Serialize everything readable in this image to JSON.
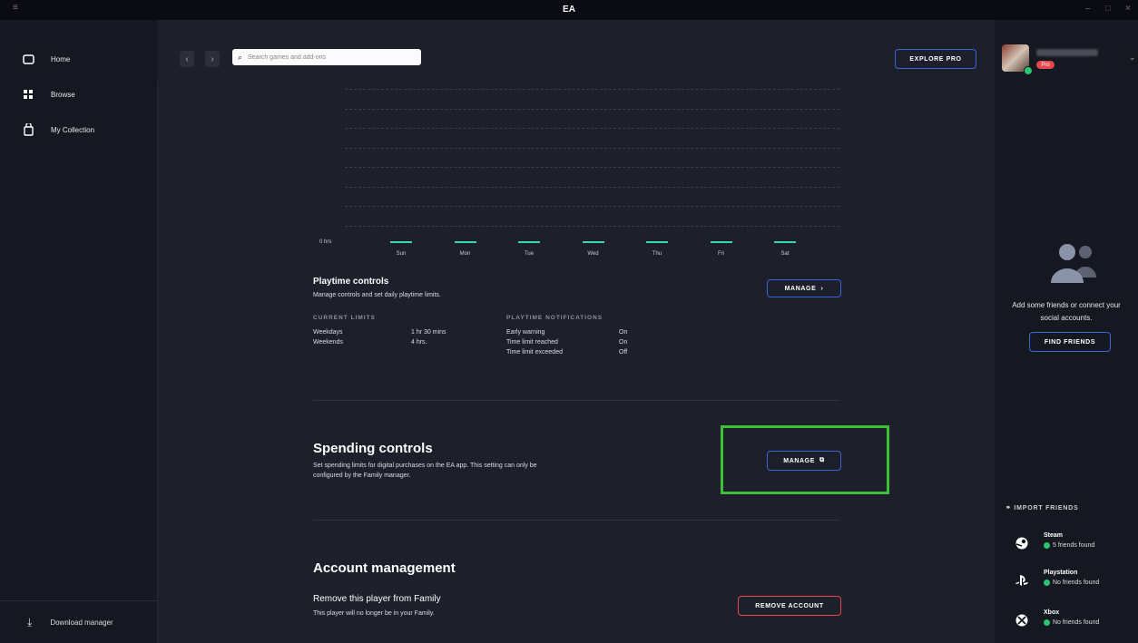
{
  "window": {
    "title": "EA"
  },
  "sidebar": {
    "items": [
      {
        "label": "Home",
        "icon": "home-icon"
      },
      {
        "label": "Browse",
        "icon": "browse-icon"
      },
      {
        "label": "My Collection",
        "icon": "collection-icon"
      }
    ],
    "download_manager": "Download manager"
  },
  "search": {
    "placeholder": "Search games and add-ons"
  },
  "explore_button": "EXPLORE PRO",
  "profile": {
    "badge": "Pro"
  },
  "chart_data": {
    "type": "bar",
    "categories": [
      "Sun",
      "Mon",
      "Tue",
      "Wed",
      "Thu",
      "Fri",
      "Sat"
    ],
    "values": [
      0,
      0,
      0,
      0,
      0,
      0,
      0
    ],
    "ylabel_zero": "0 hrs",
    "grid": true
  },
  "playtime": {
    "title": "Playtime controls",
    "desc": "Manage controls and set daily playtime limits.",
    "manage_label": "MANAGE",
    "current_limits_caption": "CURRENT LIMITS",
    "limits": [
      {
        "label": "Weekdays",
        "value": "1 hr 30 mins"
      },
      {
        "label": "Weekends",
        "value": "4 hrs."
      }
    ],
    "notifications_caption": "PLAYTIME NOTIFICATIONS",
    "notifications": [
      {
        "label": "Early warning",
        "value": "On"
      },
      {
        "label": "Time limit reached",
        "value": "On"
      },
      {
        "label": "Time limit exceeded",
        "value": "Off"
      }
    ]
  },
  "spending": {
    "title": "Spending controls",
    "desc_line1": "Set spending limits for digital purchases on the EA app. This setting can only be",
    "desc_line2": "configured by the Family manager.",
    "manage_label": "MANAGE"
  },
  "account": {
    "title": "Account management",
    "remove_title": "Remove this player from Family",
    "remove_desc": "This player will no longer be in your Family.",
    "remove_button": "REMOVE ACCOUNT"
  },
  "friends": {
    "empty_line1": "Add some friends or connect your",
    "empty_line2": "social accounts.",
    "find_button": "FIND FRIENDS",
    "import_title": "IMPORT FRIENDS",
    "imports": [
      {
        "name": "Steam",
        "status": "5 friends found",
        "icon": "steam-icon"
      },
      {
        "name": "Playstation",
        "status": "No friends found",
        "icon": "playstation-icon"
      },
      {
        "name": "Xbox",
        "status": "No friends found",
        "icon": "xbox-icon"
      }
    ]
  },
  "colors": {
    "accent": "#3d63d9",
    "danger": "#e5484d",
    "success": "#28c76f",
    "highlight": "#3cc03a",
    "bar": "#3ad6b0"
  }
}
